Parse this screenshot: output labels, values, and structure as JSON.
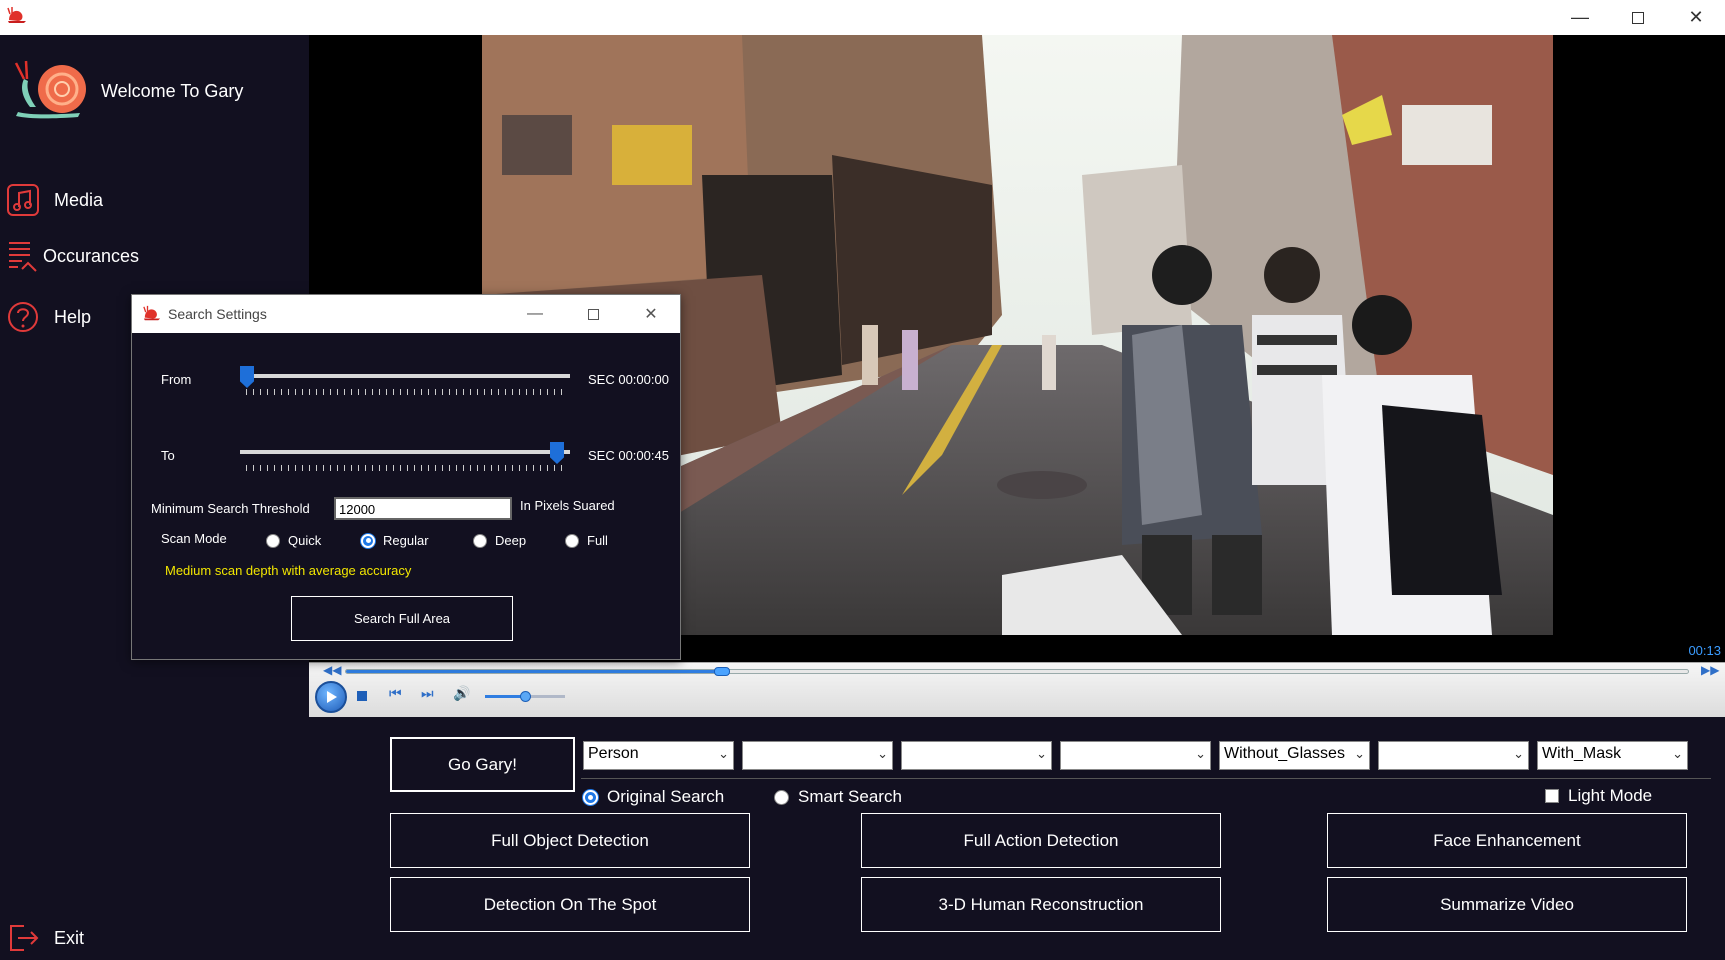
{
  "window": {
    "minimize_icon": "minimize-icon",
    "maximize_icon": "maximize-icon",
    "close_icon": "close-icon"
  },
  "sidebar": {
    "welcome": "Welcome To Gary",
    "items": [
      {
        "label": "Media",
        "icon": "music-note-icon"
      },
      {
        "label": "Occurances",
        "icon": "list-icon"
      },
      {
        "label": "Help",
        "icon": "question-icon"
      }
    ],
    "exit": {
      "label": "Exit",
      "icon": "exit-icon"
    }
  },
  "player": {
    "time": "00:13",
    "seek_progress": 0.28,
    "volume": 0.5
  },
  "controls": {
    "go_label": "Go Gary!",
    "combos": [
      "Person",
      "",
      "",
      "",
      "Without_Glasses",
      "",
      "With_Mask"
    ],
    "search_original": "Original Search",
    "search_smart": "Smart Search",
    "search_selected": "original",
    "light_mode": "Light Mode",
    "light_mode_checked": false,
    "buttons": [
      "Full Object Detection",
      "Full Action Detection",
      "Face Enhancement",
      "Detection On The Spot",
      "3-D Human Reconstruction",
      "Summarize Video"
    ]
  },
  "dialog": {
    "title": "Search Settings",
    "from_label": "From",
    "to_label": "To",
    "from_time": "SEC 00:00:00",
    "to_time": "SEC 00:00:45",
    "from_value": 0.0,
    "to_value": 1.0,
    "threshold_label": "Minimum Search Threshold",
    "threshold_value": "12000",
    "threshold_unit": "In Pixels Suared",
    "scan_mode_label": "Scan Mode",
    "scan_modes": [
      "Quick",
      "Regular",
      "Deep",
      "Full"
    ],
    "scan_selected": "Regular",
    "hint": "Medium scan depth with average accuracy",
    "button": "Search Full Area"
  },
  "colors": {
    "accent": "#1e78e6",
    "brand": "#e0312a",
    "panel": "#121020",
    "hint": "#f2e600"
  }
}
